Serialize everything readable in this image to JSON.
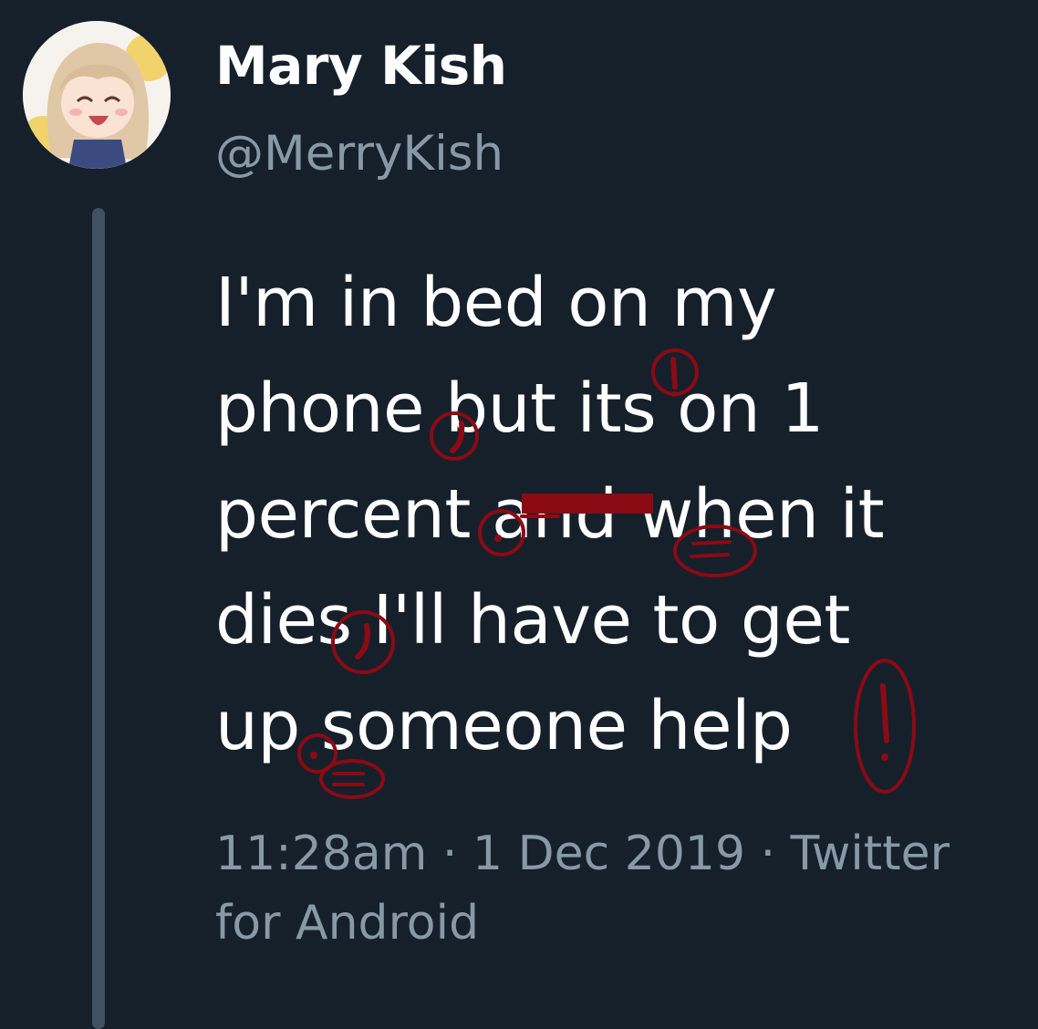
{
  "author": {
    "display_name": "Mary Kish",
    "handle": "@MerryKish",
    "avatar_badge": "M"
  },
  "tweet": {
    "lines": [
      "I'm in bed on my",
      "phone but its on 1",
      "percent and when it",
      "dies I'll have to get",
      "up someone help"
    ]
  },
  "meta": {
    "time": "11:28am",
    "separator": "·",
    "date": "1 Dec 2019",
    "source_line1": "Twitter",
    "source_line2": "for Android"
  },
  "colors": {
    "background": "#15202b",
    "text": "#ffffff",
    "secondary_text": "#8899a6",
    "thread_line": "#3f5163",
    "annotation_red": "#8b0a14"
  }
}
